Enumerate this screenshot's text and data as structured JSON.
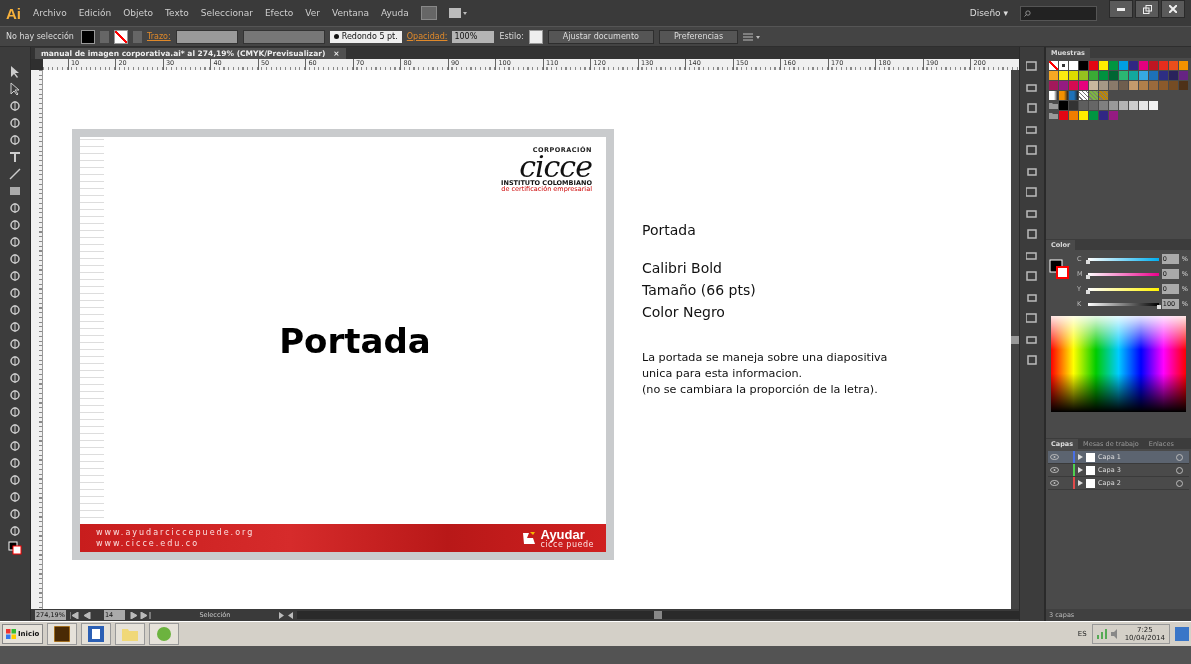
{
  "app_bar": {
    "logo": "Ai",
    "menus": [
      "Archivo",
      "Edición",
      "Objeto",
      "Texto",
      "Seleccionar",
      "Efecto",
      "Ver",
      "Ventana",
      "Ayuda"
    ],
    "workspace": "Diseño",
    "workspace_caret": "▾"
  },
  "control_bar": {
    "selection": "No hay selección",
    "stroke_label": "Trazo:",
    "brush": "Redondo 5 pt.",
    "opacity_label": "Opacidad:",
    "opacity": "100%",
    "style_label": "Estilo:",
    "buttons": [
      "Ajustar documento",
      "Preferencias"
    ]
  },
  "document": {
    "tab": "manual de imagen corporativa.ai* al 274,19% (CMYK/Previsualizar)",
    "tab_close": "×",
    "ruler": [
      "10",
      "20",
      "30",
      "40",
      "50",
      "60",
      "70",
      "80",
      "90",
      "100",
      "110",
      "120",
      "130",
      "140",
      "150",
      "160",
      "170",
      "180",
      "190",
      "200"
    ],
    "slide": {
      "logo_top": "CORPORACIÓN",
      "logo_word": "cicce",
      "logo_line1": "INSTITUTO COLOMBIANO",
      "logo_line2": "de certificación empresarial",
      "title": "Portada",
      "urls": [
        "www.ayudarciccepuede.org",
        "www.cicce.edu.co"
      ],
      "brand": "Ayudar",
      "brand_sub": "cicce puede"
    },
    "notes": {
      "title": "Portada",
      "specs": [
        "Calibri Bold",
        "Tamaño (66 pts)",
        "Color Negro"
      ],
      "description": [
        "La portada se maneja sobre una diapositiva",
        "unica para esta informacion.",
        "(no se cambiara la proporción de la letra)."
      ]
    }
  },
  "status_bar": {
    "zoom": "274,19%",
    "artboard": "14",
    "tool": "Selección"
  },
  "swatches_panel": {
    "title": "Muestras",
    "rows": [
      [
        {
          "kind": "none"
        },
        {
          "kind": "registration"
        },
        {
          "kind": "solid",
          "color": "#ffffff"
        },
        {
          "kind": "solid",
          "color": "#000000"
        },
        {
          "kind": "solid",
          "color": "#e30613"
        },
        {
          "kind": "solid",
          "color": "#ffed00"
        },
        {
          "kind": "solid",
          "color": "#009640"
        },
        {
          "kind": "solid",
          "color": "#009fe3"
        },
        {
          "kind": "solid",
          "color": "#312783"
        },
        {
          "kind": "solid",
          "color": "#e6007e"
        },
        {
          "kind": "solid",
          "color": "#be1622"
        },
        {
          "kind": "solid",
          "color": "#e52d1d"
        },
        {
          "kind": "solid",
          "color": "#e94e1b"
        },
        {
          "kind": "solid",
          "color": "#f39200"
        }
      ],
      [
        {
          "kind": "solid",
          "color": "#f7a823"
        },
        {
          "kind": "solid",
          "color": "#fcea10"
        },
        {
          "kind": "solid",
          "color": "#dedc00"
        },
        {
          "kind": "solid",
          "color": "#95c11f"
        },
        {
          "kind": "solid",
          "color": "#3aaa35"
        },
        {
          "kind": "solid",
          "color": "#00913f"
        },
        {
          "kind": "solid",
          "color": "#006633"
        },
        {
          "kind": "solid",
          "color": "#2bb673"
        },
        {
          "kind": "solid",
          "color": "#13a89e"
        },
        {
          "kind": "solid",
          "color": "#36a9e1"
        },
        {
          "kind": "solid",
          "color": "#1d71b8"
        },
        {
          "kind": "solid",
          "color": "#2d2e83"
        },
        {
          "kind": "solid",
          "color": "#29235c"
        },
        {
          "kind": "solid",
          "color": "#662483"
        }
      ],
      [
        {
          "kind": "solid",
          "color": "#a3195b"
        },
        {
          "kind": "solid",
          "color": "#951b81"
        },
        {
          "kind": "solid",
          "color": "#d60b52"
        },
        {
          "kind": "solid",
          "color": "#e5007d"
        },
        {
          "kind": "solid",
          "color": "#c8b79e"
        },
        {
          "kind": "solid",
          "color": "#a69886"
        },
        {
          "kind": "solid",
          "color": "#8a7a6a"
        },
        {
          "kind": "solid",
          "color": "#6f5e4e"
        },
        {
          "kind": "solid",
          "color": "#c49a6c"
        },
        {
          "kind": "solid",
          "color": "#b17f4a"
        },
        {
          "kind": "solid",
          "color": "#9b6a3c"
        },
        {
          "kind": "solid",
          "color": "#8b5a2b"
        },
        {
          "kind": "solid",
          "color": "#754c24"
        },
        {
          "kind": "solid",
          "color": "#4e3118"
        }
      ],
      [
        {
          "kind": "gradient",
          "color": "#ffffff"
        },
        {
          "kind": "gradient",
          "color": "#f39200"
        },
        {
          "kind": "gradient",
          "color": "#1d71b8"
        },
        {
          "kind": "pattern",
          "color": "#ffffff"
        },
        {
          "kind": "pattern",
          "color": "#7cb342"
        },
        {
          "kind": "pattern",
          "color": "#b8860b"
        }
      ],
      [
        {
          "kind": "folder"
        },
        {
          "kind": "solid",
          "color": "#000000"
        },
        {
          "kind": "solid",
          "color": "#333333"
        },
        {
          "kind": "solid",
          "color": "#5e5e5e"
        },
        {
          "kind": "solid",
          "color": "#666666"
        },
        {
          "kind": "solid",
          "color": "#808080"
        },
        {
          "kind": "solid",
          "color": "#999999"
        },
        {
          "kind": "solid",
          "color": "#b3b3b3"
        },
        {
          "kind": "solid",
          "color": "#cccccc"
        },
        {
          "kind": "solid",
          "color": "#e6e6e6"
        },
        {
          "kind": "solid",
          "color": "#f2f2f2"
        }
      ],
      [
        {
          "kind": "folder"
        },
        {
          "kind": "solid",
          "color": "#e30614"
        },
        {
          "kind": "solid",
          "color": "#ef7d00"
        },
        {
          "kind": "solid",
          "color": "#ffec00"
        },
        {
          "kind": "solid",
          "color": "#009641"
        },
        {
          "kind": "solid",
          "color": "#312784"
        },
        {
          "kind": "solid",
          "color": "#951b82"
        }
      ]
    ]
  },
  "color_panel": {
    "title": "Color",
    "channels": [
      {
        "name": "C",
        "level": 0,
        "value": "0",
        "unit": "%"
      },
      {
        "name": "M",
        "level": 0,
        "value": "0",
        "unit": "%"
      },
      {
        "name": "Y",
        "level": 0,
        "value": "0",
        "unit": "%"
      },
      {
        "name": "K",
        "level": 1,
        "value": "100",
        "unit": "%"
      }
    ]
  },
  "layers_panel": {
    "tabs": [
      {
        "label": "Capas",
        "selected": true
      },
      {
        "label": "Mesas de trabajo",
        "selected": false
      },
      {
        "label": "Enlaces",
        "selected": false
      }
    ],
    "layers": [
      {
        "name": "Capa 1",
        "color": "#4a6fe3",
        "selected": true,
        "visible": true
      },
      {
        "name": "Capa 3",
        "color": "#4fd04f",
        "selected": false,
        "visible": true
      },
      {
        "name": "Capa 2",
        "color": "#e04a4a",
        "selected": false,
        "visible": true
      }
    ],
    "count": "3 capas"
  },
  "taskbar": {
    "start": "Inicio",
    "language": "ES",
    "time": "7:25",
    "date": "10/04/2014"
  }
}
